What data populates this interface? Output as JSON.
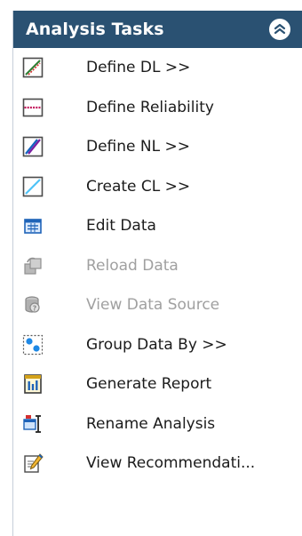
{
  "panel": {
    "title": "Analysis Tasks",
    "collapse_icon": "double-chevron-up-icon"
  },
  "tasks": [
    {
      "label": "Define DL >>",
      "icon": "define-dl-chart-icon",
      "enabled": true
    },
    {
      "label": "Define Reliability",
      "icon": "reliability-line-icon",
      "enabled": true
    },
    {
      "label": "Define NL >>",
      "icon": "define-nl-chart-icon",
      "enabled": true
    },
    {
      "label": "Create CL >>",
      "icon": "create-cl-chart-icon",
      "enabled": true
    },
    {
      "label": "Edit Data",
      "icon": "data-grid-icon",
      "enabled": true
    },
    {
      "label": "Reload Data",
      "icon": "reload-data-icon",
      "enabled": false
    },
    {
      "label": "View Data Source",
      "icon": "data-source-icon",
      "enabled": false
    },
    {
      "label": "Group Data By >>",
      "icon": "group-data-icon",
      "enabled": true
    },
    {
      "label": "Generate Report",
      "icon": "report-icon",
      "enabled": true
    },
    {
      "label": "Rename Analysis",
      "icon": "rename-icon",
      "enabled": true
    },
    {
      "label": "View Recommendati...",
      "icon": "recommendation-pencil-icon",
      "enabled": true
    }
  ],
  "colors": {
    "header_bg": "#2a5172",
    "header_text": "#ffffff",
    "item_text": "#1b1b1b",
    "disabled_text": "#a0a0a0"
  }
}
